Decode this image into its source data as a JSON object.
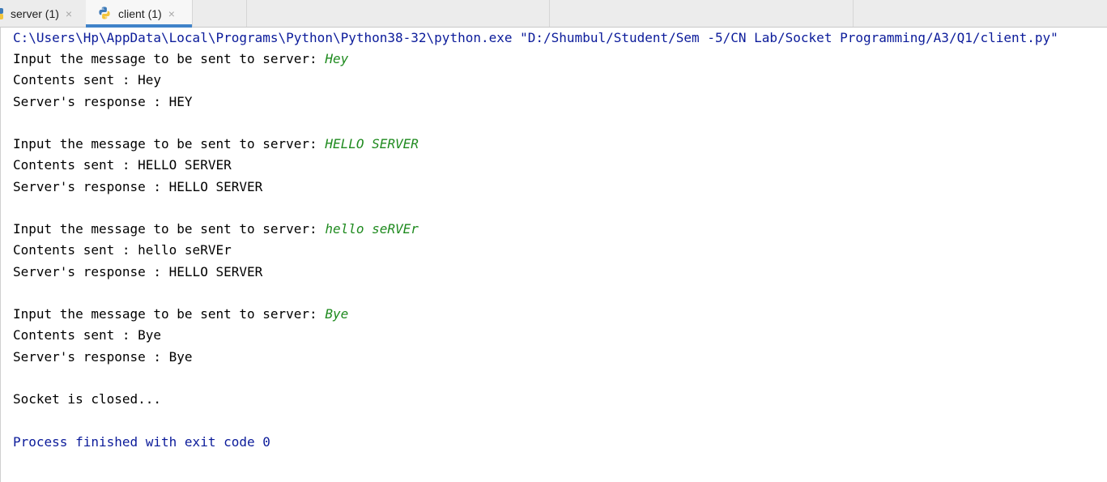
{
  "tabs": [
    {
      "label": "server (1)",
      "close": "×",
      "icon": "python-file-icon",
      "active": false
    },
    {
      "label": "client (1)",
      "close": "×",
      "icon": "python-file-icon",
      "active": true
    }
  ],
  "colors": {
    "command": "#0b1b9a",
    "input": "#1e8a1e",
    "output": "#000000",
    "active_tab_underline": "#4083c9"
  },
  "console": {
    "command": "C:\\Users\\Hp\\AppData\\Local\\Programs\\Python\\Python38-32\\python.exe \"D:/Shumbul/Student/Sem -5/CN Lab/Socket Programming/A3/Q1/client.py\"",
    "exchanges": [
      {
        "prompt": "Input the message to be sent to server: ",
        "input": "Hey",
        "sent": "Contents sent : Hey",
        "response": "Server's response : HEY"
      },
      {
        "prompt": "Input the message to be sent to server: ",
        "input": "HELLO SERVER",
        "sent": "Contents sent : HELLO SERVER",
        "response": "Server's response : HELLO SERVER"
      },
      {
        "prompt": "Input the message to be sent to server: ",
        "input": "hello seRVEr",
        "sent": "Contents sent : hello seRVEr",
        "response": "Server's response : HELLO SERVER"
      },
      {
        "prompt": "Input the message to be sent to server: ",
        "input": "Bye",
        "sent": "Contents sent : Bye",
        "response": "Server's response : Bye"
      }
    ],
    "closed": "Socket is closed...",
    "exit": "Process finished with exit code 0"
  }
}
